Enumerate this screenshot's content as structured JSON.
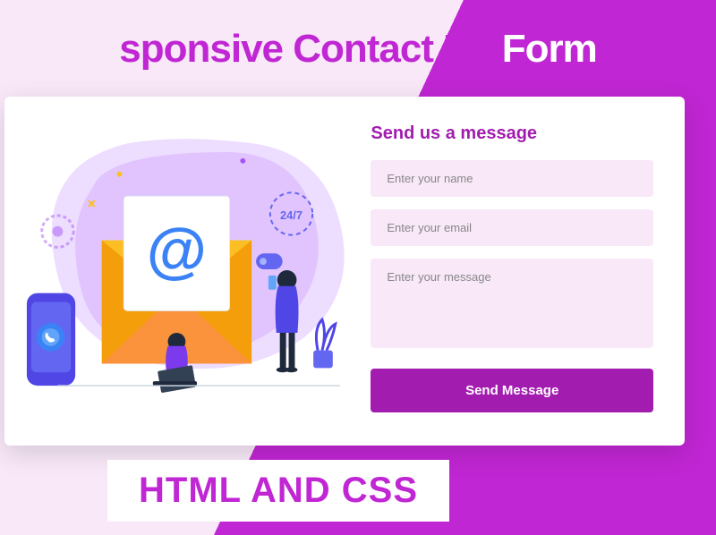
{
  "title": {
    "part1": "sponsive Contact Us",
    "part2": "Form"
  },
  "form": {
    "heading": "Send us a message",
    "name_placeholder": "Enter your name",
    "email_placeholder": "Enter your email",
    "message_placeholder": "Enter your message",
    "submit_label": "Send Message"
  },
  "footer": {
    "text": "HTML AND CSS"
  },
  "icons": {
    "at_sign": "@",
    "support_badge": "24/7"
  },
  "colors": {
    "accent": "#c026d3",
    "button": "#a21caf",
    "input_bg": "#f8e8f8"
  }
}
